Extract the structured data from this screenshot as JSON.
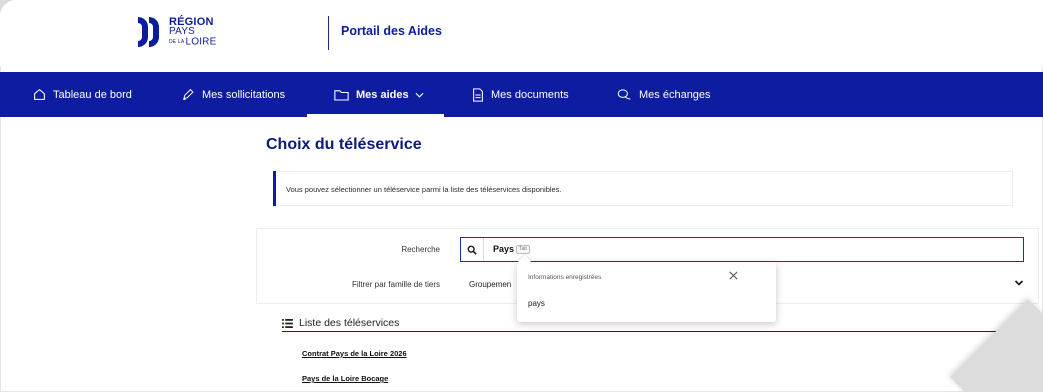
{
  "header": {
    "logo_line1": "RÉGION",
    "logo_line2": "PAYS",
    "logo_line3_small": "DE LA",
    "logo_line3": "LOIRE",
    "portal_title": "Portail des Aides"
  },
  "nav": {
    "items": [
      {
        "label": "Tableau de bord",
        "icon": "home-icon"
      },
      {
        "label": "Mes sollicitations",
        "icon": "pen-icon"
      },
      {
        "label": "Mes aides",
        "icon": "folder-icon",
        "active": true
      },
      {
        "label": "Mes documents",
        "icon": "document-icon"
      },
      {
        "label": "Mes échanges",
        "icon": "chat-icon"
      }
    ]
  },
  "main": {
    "title": "Choix du téléservice",
    "info_text": "Vous pouvez sélectionner un téléservice parmi la liste des téléservices disponibles.",
    "search": {
      "label": "Recherche",
      "value": "Pays",
      "badge": "Tab"
    },
    "filter": {
      "label": "Filtrer par famille de tiers",
      "selected": "Groupemen"
    },
    "autocomplete": {
      "header": "Informations enregistrées",
      "items": [
        "pays"
      ]
    },
    "list": {
      "title": "Liste des téléservices",
      "links": [
        "Contrat Pays de la Loire 2026",
        "Pays de la Loire Bocage"
      ]
    }
  },
  "colors": {
    "brand_blue": "#0d1ca0",
    "title_blue": "#0b1a7a"
  }
}
